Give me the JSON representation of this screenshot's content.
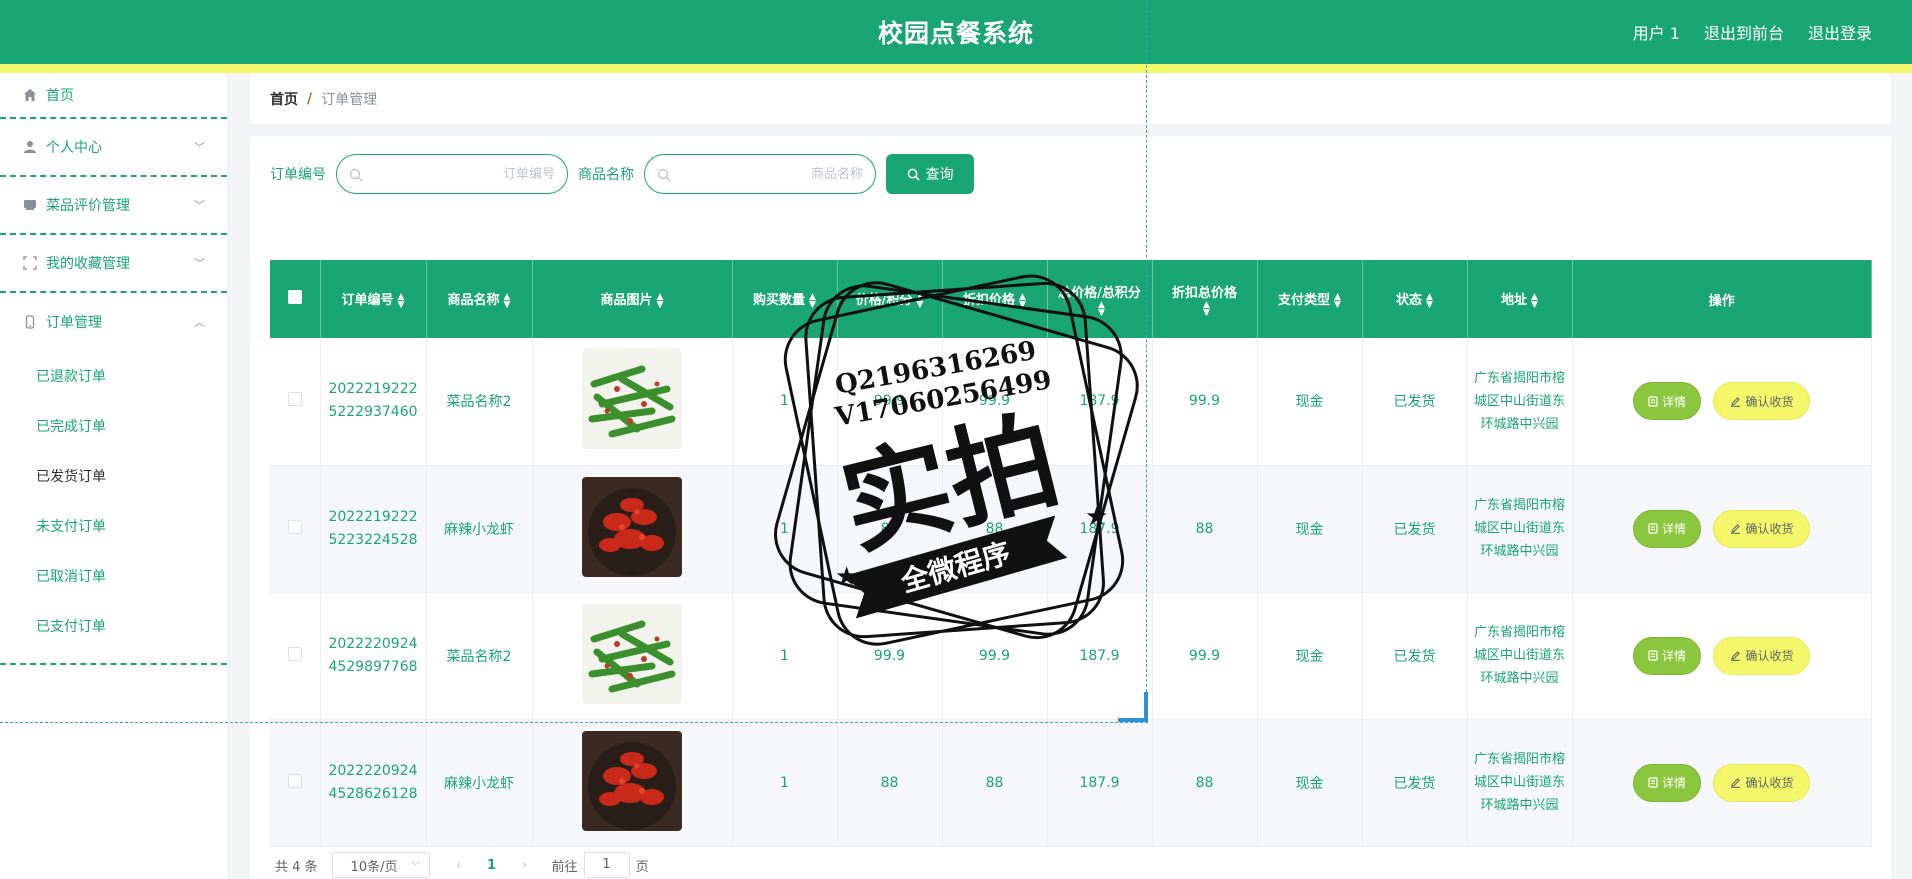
{
  "header": {
    "title": "校园点餐系统",
    "links": [
      "用户 1",
      "退出到前台",
      "退出登录"
    ]
  },
  "sidebar": {
    "items": [
      {
        "label": "首页",
        "icon": "home-icon"
      },
      {
        "label": "个人中心",
        "icon": "user-icon"
      },
      {
        "label": "菜品评价管理",
        "icon": "comment-icon"
      },
      {
        "label": "我的收藏管理",
        "icon": "collection-icon"
      },
      {
        "label": "订单管理",
        "icon": "phone-icon"
      }
    ],
    "order_submenu": [
      "已退款订单",
      "已完成订单",
      "已发货订单",
      "未支付订单",
      "已取消订单",
      "已支付订单"
    ],
    "active_submenu": "已发货订单"
  },
  "breadcrumb": {
    "home": "首页",
    "separator": "/",
    "current": "订单管理"
  },
  "search": {
    "order_no_label": "订单编号",
    "order_no_placeholder": "订单编号",
    "product_label": "商品名称",
    "product_placeholder": "商品名称",
    "query_button": "查询"
  },
  "table": {
    "columns": [
      "订单编号",
      "商品名称",
      "商品图片",
      "购买数量",
      "价格/积分",
      "折扣价格",
      "总价格/总积分",
      "折扣总价格",
      "支付类型",
      "状态",
      "地址",
      "操作"
    ],
    "rows": [
      {
        "order_no_1": "2022219222",
        "order_no_2": "5222937460",
        "product": "菜品名称2",
        "image": "green-beans",
        "qty": "1",
        "price": "99.9",
        "discount": "99.9",
        "total": "187.9",
        "discount_total": "99.9",
        "pay_type": "现金",
        "status": "已发货",
        "address": "广东省揭阳市榕城区中山街道东环城路中兴园"
      },
      {
        "order_no_1": "2022219222",
        "order_no_2": "5223224528",
        "product": "麻辣小龙虾",
        "image": "crayfish",
        "qty": "1",
        "price": "88",
        "discount": "88",
        "total": "187.9",
        "discount_total": "88",
        "pay_type": "现金",
        "status": "已发货",
        "address": "广东省揭阳市榕城区中山街道东环城路中兴园"
      },
      {
        "order_no_1": "2022220924",
        "order_no_2": "4529897768",
        "product": "菜品名称2",
        "image": "green-beans",
        "qty": "1",
        "price": "99.9",
        "discount": "99.9",
        "total": "187.9",
        "discount_total": "99.9",
        "pay_type": "现金",
        "status": "已发货",
        "address": "广东省揭阳市榕城区中山街道东环城路中兴园"
      },
      {
        "order_no_1": "2022220924",
        "order_no_2": "4528626128",
        "product": "麻辣小龙虾",
        "image": "crayfish",
        "qty": "1",
        "price": "88",
        "discount": "88",
        "total": "187.9",
        "discount_total": "88",
        "pay_type": "现金",
        "status": "已发货",
        "address": "广东省揭阳市榕城区中山街道东环城路中兴园"
      }
    ],
    "detail_button": "详情",
    "confirm_button": "确认收货"
  },
  "pagination": {
    "total": "共 4 条",
    "page_size": "10条/页",
    "current_page": "1",
    "goto_prefix": "前往",
    "goto_value": "1",
    "goto_suffix": "页"
  },
  "watermark": {
    "line1": "Q2196316269",
    "line2": "V17060256499",
    "big": "实拍",
    "banner": "全微程序"
  },
  "colors": {
    "primary": "#1aa574",
    "strip": "#f4f76a",
    "detail": "#8cc63e",
    "confirm": "#f4f76a"
  }
}
